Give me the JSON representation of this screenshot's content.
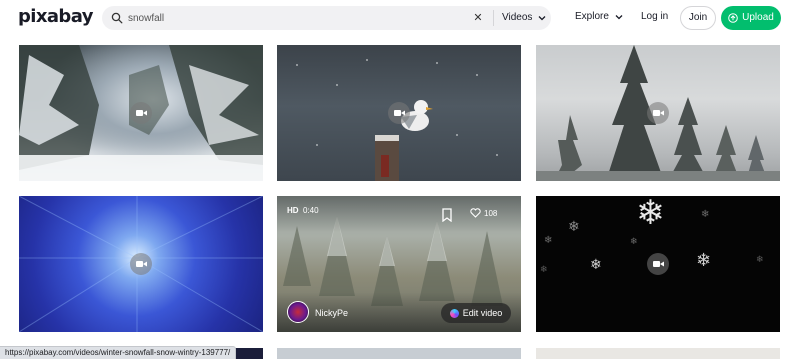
{
  "header": {
    "logo": "pixabay",
    "search": {
      "value": "snowfall",
      "placeholder": ""
    },
    "media_type": "Videos",
    "nav": {
      "explore": "Explore",
      "login": "Log in",
      "join": "Join",
      "upload": "Upload"
    }
  },
  "colors": {
    "accent": "#02be6e",
    "text": "#191b26",
    "search_bg": "#f1f1f3"
  },
  "results": [
    {
      "kind": "video",
      "scene": "snow-covered fir trees forest"
    },
    {
      "kind": "video",
      "scene": "seagull on post in snowfall"
    },
    {
      "kind": "video",
      "scene": "snowy fir trees in fog"
    },
    {
      "kind": "video",
      "scene": "aerial blue snowy forest"
    },
    {
      "kind": "video",
      "scene": "snow on pine forest",
      "hovered": true,
      "badge": "HD",
      "duration": "0:40",
      "likes": "108",
      "author": "NickyPe",
      "action": "Edit video"
    },
    {
      "kind": "video",
      "scene": "snowflakes on black"
    }
  ],
  "icons": [
    "search-icon",
    "close-icon",
    "chevron-down-icon",
    "upload-icon",
    "video-camera-icon",
    "bookmark-icon",
    "heart-icon"
  ],
  "status_url": "https://pixabay.com/videos/winter-snowfall-snow-wintry-139777/"
}
